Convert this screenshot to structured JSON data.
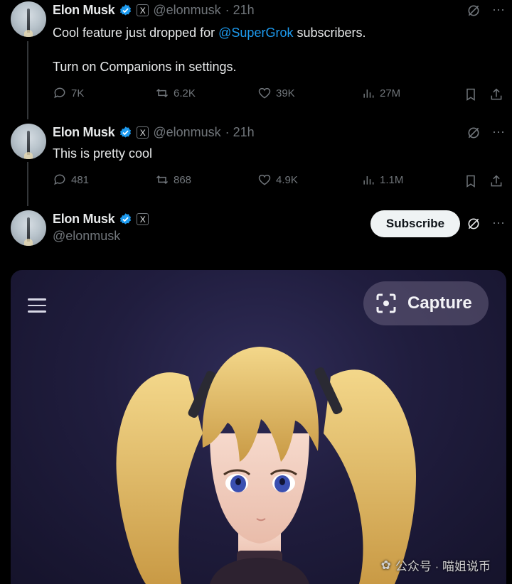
{
  "tweets": [
    {
      "name": "Elon Musk",
      "handle": "@elonmusk",
      "time": "· 21h",
      "text_before": "Cool feature just dropped for ",
      "mention": "@SuperGrok",
      "text_after": " subscribers.",
      "text_line2": "Turn on Companions in settings.",
      "replies": "7K",
      "reposts": "6.2K",
      "likes": "39K",
      "views": "27M"
    },
    {
      "name": "Elon Musk",
      "handle": "@elonmusk",
      "time": "· 21h",
      "text": "This is pretty cool",
      "replies": "481",
      "reposts": "868",
      "likes": "4.9K",
      "views": "1.1M"
    }
  ],
  "profile": {
    "name": "Elon Musk",
    "handle": "@elonmusk",
    "subscribe_label": "Subscribe"
  },
  "media": {
    "capture_label": "Capture"
  },
  "watermark": "公众号 · 喵姐说币",
  "icons": {
    "x_badge": "X"
  },
  "colors": {
    "background": "#000000",
    "text": "#e7e9ea",
    "muted": "#71767b",
    "link": "#1d9bf0",
    "verified": "#1d9bf0"
  }
}
